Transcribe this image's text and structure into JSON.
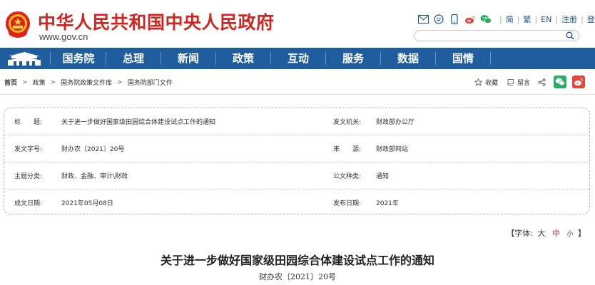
{
  "header": {
    "site_title": "中华人民共和国中央人民政府",
    "site_url": "www.gov.cn",
    "tools": {
      "simplified": "简",
      "traditional": "繁",
      "english": "EN",
      "register": "注册",
      "login": "登录"
    },
    "search": {
      "placeholder": ""
    }
  },
  "nav": {
    "items": [
      "国务院",
      "总理",
      "新闻",
      "政策",
      "互动",
      "服务",
      "数据",
      "国情"
    ]
  },
  "breadcrumb": {
    "items": [
      "首页",
      "政策",
      "国务院政策文件库",
      "国务院部门文件"
    ],
    "separator": ">"
  },
  "share": {
    "favorite_label": "收藏",
    "comment_label": "留言"
  },
  "info": {
    "title_label": "标　　题:",
    "title_value": "关于进一步做好国家级田园综合体建设试点工作的通知",
    "issuer_label": "发文机关:",
    "issuer_value": "财政部办公厅",
    "docno_label": "发文字号:",
    "docno_value": "财办农〔2021〕20号",
    "source_label": "来　　源:",
    "source_value": "财政部网站",
    "topic_label": "主题分类:",
    "topic_value": "财政、金融、审计\\财政",
    "type_label": "公文种类:",
    "type_value": "通知",
    "date_label": "成文日期:",
    "date_value": "2021年05月08日",
    "pub_label": "发布日期:",
    "pub_value": "2021年"
  },
  "font_control": {
    "prefix": "【字体:",
    "large": "大",
    "medium": "中",
    "small": "小",
    "suffix": "】"
  },
  "document": {
    "title": "关于进一步做好国家级田园综合体建设试点工作的通知",
    "number": "财办农〔2021〕20号"
  },
  "colors": {
    "brand_red": "#d0261f",
    "nav_blue": "#1f5d9e",
    "wechat_green": "#2aae67",
    "weibo_red": "#e6453c"
  }
}
